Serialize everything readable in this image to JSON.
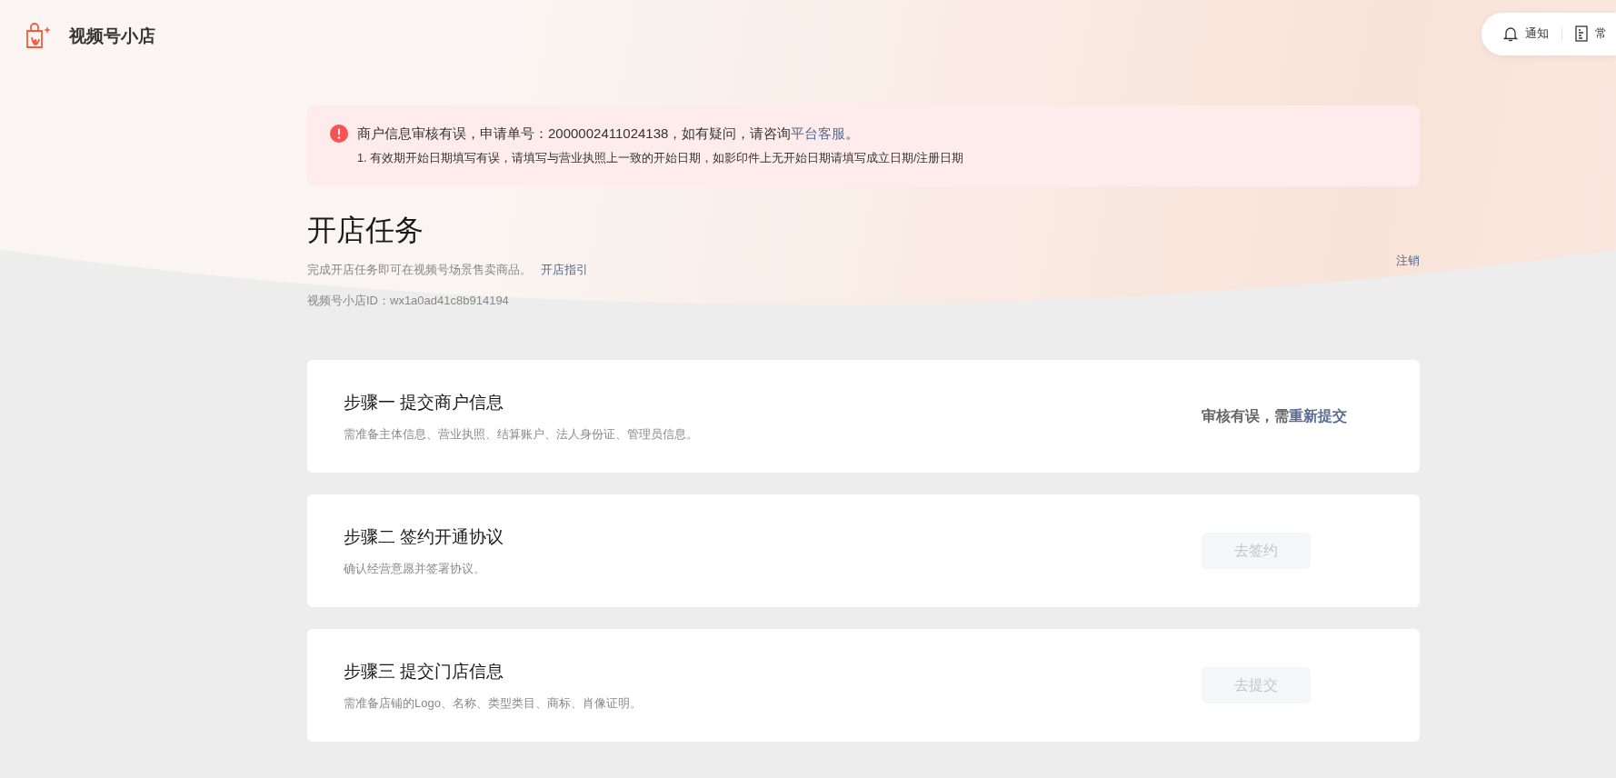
{
  "brand": {
    "name": "视频号小店"
  },
  "top_actions": [
    {
      "label": "通知",
      "kind": "bell"
    },
    {
      "label": "常",
      "kind": "doc"
    }
  ],
  "alert": {
    "message": "商户信息审核有误，申请单号：2000002411024138，如有疑问，请咨询",
    "link": "平台客服",
    "message_end": "。",
    "details": [
      "1. 有效期开始日期填写有误，请填写与营业执照上一致的开始日期，如影印件上无开始日期请填写成立日期/注册日期"
    ]
  },
  "page": {
    "title": "开店任务",
    "subtitle": "完成开店任务即可在视频号场景售卖商品。",
    "guide_link": "开店指引",
    "shop_id": "视频号小店ID：wx1a0ad41c8b914194",
    "logout": "注销"
  },
  "steps": [
    {
      "title": "步骤一 提交商户信息",
      "description": "需准备主体信息、营业执照、结算账户、法人身份证、管理员信息。",
      "action": {
        "kind": "status",
        "text": "审核有误，需",
        "link": "重新提交"
      }
    },
    {
      "title": "步骤二 签约开通协议",
      "description": "确认经营意愿并签署协议。",
      "action": {
        "kind": "button",
        "label": "去签约",
        "disabled": true
      }
    },
    {
      "title": "步骤三 提交门店信息",
      "description": "需准备店铺的Logo、名称、类型类目、商标、肖像证明。",
      "action": {
        "kind": "button",
        "label": "去提交",
        "disabled": true
      }
    }
  ]
}
